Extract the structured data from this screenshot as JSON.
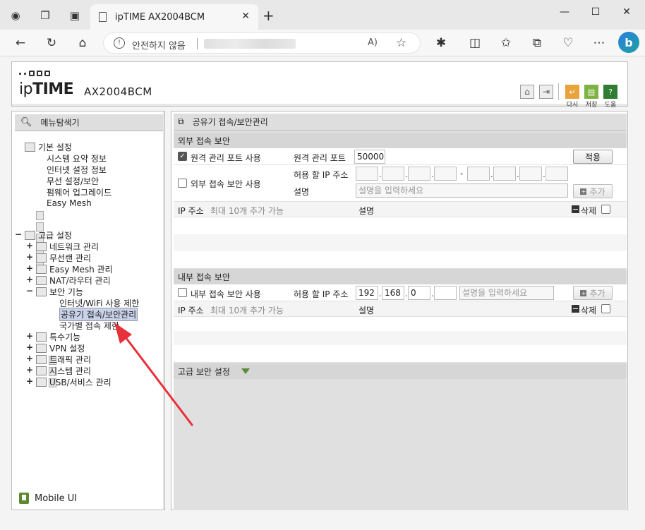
{
  "browser": {
    "tab_title": "ipTIME AX2004BCM",
    "address_warning": "안전하지 않음",
    "tab_close": "✕",
    "new_tab": "+",
    "minimize": "—",
    "maximize": "☐",
    "close": "✕"
  },
  "header": {
    "logo_ip": "ip",
    "logo_time": "TIME",
    "model": "AX2004BCM",
    "buttons": {
      "reset": "다시",
      "save": "저장",
      "help": "도움"
    }
  },
  "sidebar": {
    "title": "메뉴탐색기",
    "basic": {
      "label": "기본 설정",
      "items": [
        "시스템 요약 정보",
        "인터넷 설정 정보",
        "무선 설정/보안",
        "펌웨어 업그레이드",
        "Easy Mesh"
      ]
    },
    "advanced": {
      "label": "고급 설정",
      "items": [
        "네트워크 관리",
        "무선랜 관리",
        "Easy Mesh 관리",
        "NAT/라우터 관리",
        "보안 기능"
      ],
      "security_children": [
        "인터넷/WiFi 사용 제한",
        "공유기 접속/보안관리",
        "국가별 접속 제한"
      ],
      "items_after": [
        "특수기능",
        "VPN 설정",
        "트래픽 관리",
        "시스템 관리",
        "USB/서비스 관리"
      ]
    },
    "mobile": "Mobile UI"
  },
  "main": {
    "title": "공유기 접속/보안관리",
    "external": {
      "section": "외부 접속 보안",
      "remote_port_checkbox": "원격 관리 포트 사용",
      "remote_port_label": "원격 관리 포트",
      "remote_port_value": "50000",
      "apply": "적용",
      "ext_access_checkbox": "외부 접속 보안 사용",
      "allow_ip_label": "허용 할 IP 주소",
      "desc_label": "설명",
      "desc_placeholder": "설명을 입력하세요",
      "add": "추가",
      "range_dash": "-",
      "list_ip_header": "IP 주소",
      "list_limit": "최대 10개 추가 가능",
      "list_desc_header": "설명",
      "delete": "삭제"
    },
    "internal": {
      "section": "내부 접속 보안",
      "checkbox": "내부 접속 보안 사용",
      "allow_ip_label": "허용 할 IP 주소",
      "ip": [
        "192",
        "168",
        "0",
        ""
      ],
      "desc_placeholder": "설명을 입력하세요",
      "add": "추가",
      "list_ip_header": "IP 주소",
      "list_limit": "최대 10개 추가 가능",
      "list_desc_header": "설명",
      "delete": "삭제"
    },
    "advanced_section": "고급 보안 설정"
  },
  "colors": {
    "arrow": "#e8303a",
    "selection": "#c8d2e8",
    "accent_green": "#5a8a3a"
  }
}
